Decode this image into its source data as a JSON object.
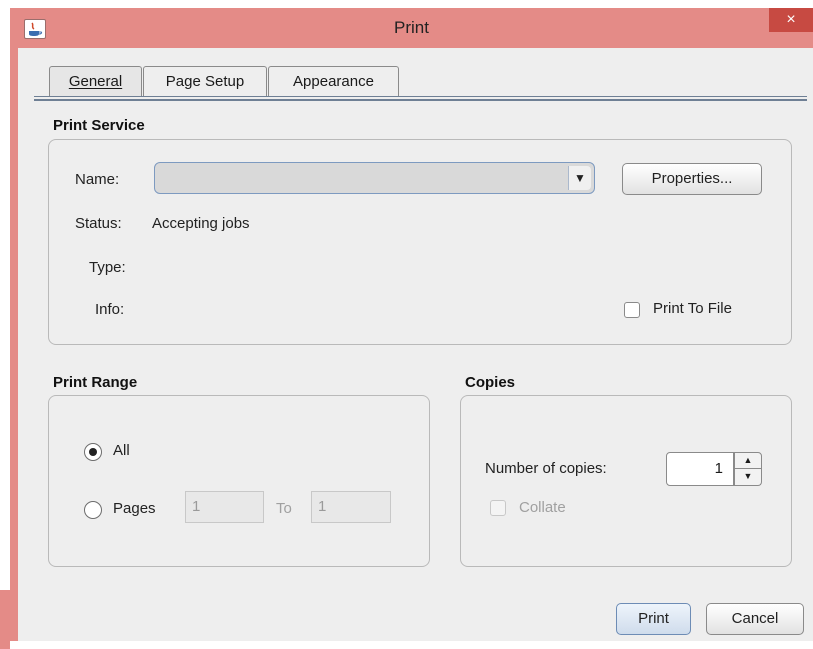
{
  "window": {
    "title": "Print",
    "close_glyph": "×",
    "app_icon": "java-app-icon"
  },
  "tabs": [
    {
      "label": "General",
      "active": true
    },
    {
      "label": "Page Setup",
      "active": false
    },
    {
      "label": "Appearance",
      "active": false
    }
  ],
  "print_service": {
    "title": "Print Service",
    "name_label": "Name:",
    "name_value": "",
    "properties_button": "Properties...",
    "status_label": "Status:",
    "status_value": "Accepting jobs",
    "type_label": "Type:",
    "type_value": "",
    "info_label": "Info:",
    "info_value": "",
    "print_to_file_label": "Print To File",
    "print_to_file_checked": false
  },
  "print_range": {
    "title": "Print Range",
    "all_label": "All",
    "all_selected": true,
    "pages_label": "Pages",
    "pages_from": "1",
    "to_label": "To",
    "pages_to": "1"
  },
  "copies": {
    "title": "Copies",
    "number_label": "Number of copies:",
    "number_value": "1",
    "collate_label": "Collate",
    "collate_enabled": false
  },
  "actions": {
    "print_button": "Print",
    "cancel_button": "Cancel"
  },
  "colors": {
    "titlebar": "#e48b87",
    "close_button": "#c74a42",
    "client_bg": "#eeeeee",
    "tab_rule": "#6e7f94"
  }
}
